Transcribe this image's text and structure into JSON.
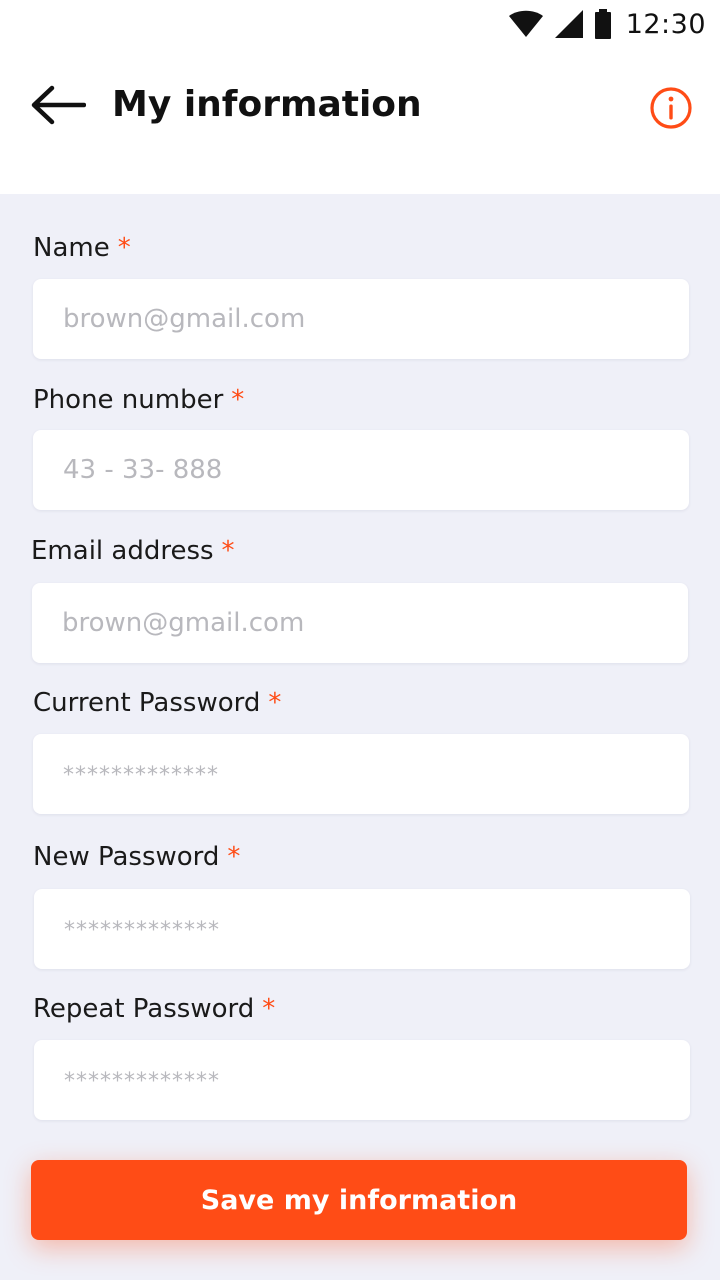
{
  "status_bar": {
    "time": "12:30",
    "icons": [
      "wifi-icon",
      "signal-icon",
      "battery-icon"
    ]
  },
  "header": {
    "title": "My information",
    "back_icon": "arrow-left-icon",
    "info_icon": "info-circle-icon"
  },
  "colors": {
    "accent": "#ff4c16",
    "background": "#eff0f8",
    "placeholder": "#b8b8bd"
  },
  "form": {
    "required_mark": "*",
    "fields": [
      {
        "label": "Name",
        "placeholder": "brown@gmail.com",
        "type": "text"
      },
      {
        "label": "Phone number",
        "placeholder": "43 - 33- 888",
        "type": "tel"
      },
      {
        "label": "Email address",
        "placeholder": "brown@gmail.com",
        "type": "email"
      },
      {
        "label": "Current Password",
        "placeholder": "*************",
        "type": "password"
      },
      {
        "label": "New Password",
        "placeholder": "*************",
        "type": "password"
      },
      {
        "label": "Repeat Password",
        "placeholder": "*************",
        "type": "password"
      }
    ],
    "submit_label": "Save my information"
  }
}
